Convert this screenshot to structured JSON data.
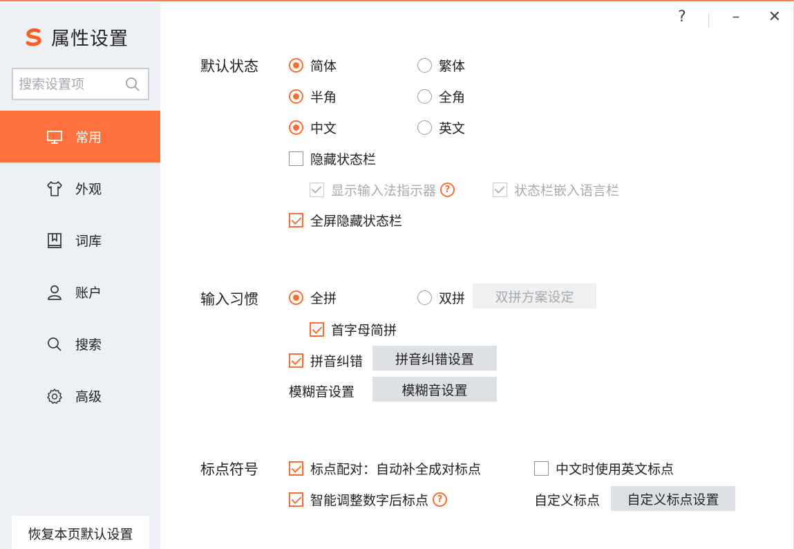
{
  "app": {
    "title": "属性设置",
    "accent_color": "#ff7240",
    "window_controls": {
      "help": "?",
      "minimize": "–",
      "close": "✕"
    }
  },
  "sidebar": {
    "search_placeholder": "搜索设置项",
    "items": [
      {
        "label": "常用",
        "icon": "monitor-icon",
        "active": true
      },
      {
        "label": "外观",
        "icon": "shirt-icon",
        "active": false
      },
      {
        "label": "词库",
        "icon": "bookmark-book-icon",
        "active": false
      },
      {
        "label": "账户",
        "icon": "user-icon",
        "active": false
      },
      {
        "label": "搜索",
        "icon": "search-icon",
        "active": false
      },
      {
        "label": "高级",
        "icon": "gear-icon",
        "active": false
      }
    ],
    "restore_label": "恢复本页默认设置"
  },
  "default_state": {
    "label": "默认状态",
    "simplified": "简体",
    "traditional": "繁体",
    "half_width": "半角",
    "full_width": "全角",
    "chinese": "中文",
    "english": "英文",
    "hide_status_bar": "隐藏状态栏",
    "show_indicator": "显示输入法指示器",
    "embed_language_bar": "状态栏嵌入语言栏",
    "fullscreen_hide_status_bar": "全屏隐藏状态栏"
  },
  "input_habits": {
    "label": "输入习惯",
    "full_pinyin": "全拼",
    "double_pinyin": "双拼",
    "double_pinyin_scheme_button": "双拼方案设定",
    "initial_abbrev": "首字母简拼",
    "pinyin_correction": "拼音纠错",
    "pinyin_correction_button": "拼音纠错设置",
    "fuzzy_label": "模糊音设置",
    "fuzzy_button": "模糊音设置"
  },
  "punctuation": {
    "label": "标点符号",
    "auto_pair": "标点配对：自动补全成对标点",
    "english_punct_in_chinese": "中文时使用英文标点",
    "smart_adjust": "智能调整数字后标点",
    "custom_label": "自定义标点",
    "custom_button": "自定义标点设置"
  }
}
